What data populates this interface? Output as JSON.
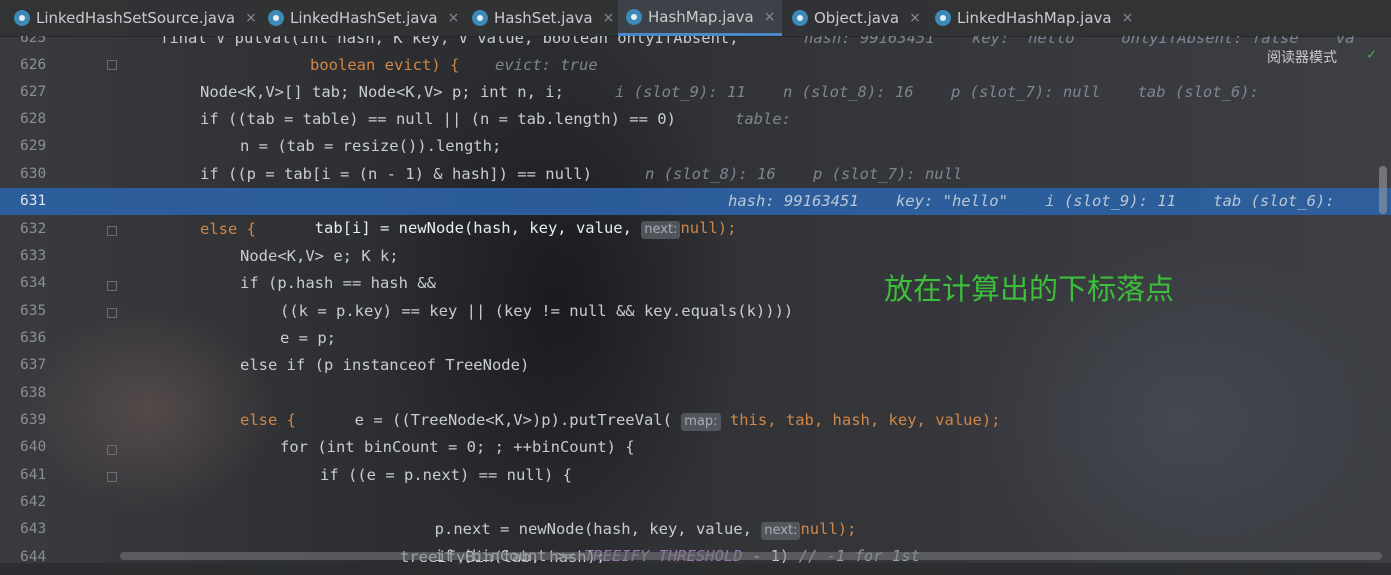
{
  "tabs": [
    {
      "label": "LinkedHashSetSource.java",
      "active": false
    },
    {
      "label": "LinkedHashSet.java",
      "active": false
    },
    {
      "label": "HashSet.java",
      "active": false
    },
    {
      "label": "HashMap.java",
      "active": true
    },
    {
      "label": "Object.java",
      "active": false
    },
    {
      "label": "LinkedHashMap.java",
      "active": false
    }
  ],
  "close_glyph": "×",
  "reader_mode": "阅读器模式",
  "annotation": "放在计算出的下标落点",
  "lines": [
    {
      "num": "625",
      "code": "final V putVal(int hash, K key, V value, boolean onlyIfAbsent,",
      "hint": "hash: 99163451    key: \"hello\"    onlyIfAbsent: false    va"
    },
    {
      "num": "626",
      "code": "boolean evict) {",
      "hint": "evict: true"
    },
    {
      "num": "627",
      "code": "Node<K,V>[] tab; Node<K,V> p; int n, i;",
      "hint": "i (slot_9): 11    n (slot_8): 16    p (slot_7): null    tab (slot_6):"
    },
    {
      "num": "628",
      "code": "if ((tab = table) == null || (n = tab.length) == 0)",
      "hint": "table:"
    },
    {
      "num": "629",
      "code": "n = (tab = resize()).length;",
      "hint": ""
    },
    {
      "num": "630",
      "code": "if ((p = tab[i = (n - 1) & hash]) == null)",
      "hint": "n (slot_8): 16    p (slot_7): null"
    },
    {
      "num": "631",
      "code_a": "tab[i] = newNode(hash, key, value, ",
      "param": "next:",
      "code_b": "null);",
      "hint": "hash: 99163451    key: \"hello\"    i (slot_9): 11    tab (slot_6):"
    },
    {
      "num": "632",
      "code": "else {",
      "hint": ""
    },
    {
      "num": "633",
      "code": "Node<K,V> e; K k;",
      "hint": ""
    },
    {
      "num": "634",
      "code": "if (p.hash == hash &&",
      "hint": ""
    },
    {
      "num": "635",
      "code": "((k = p.key) == key || (key != null && key.equals(k))))",
      "hint": ""
    },
    {
      "num": "636",
      "code": "e = p;",
      "hint": ""
    },
    {
      "num": "637",
      "code": "else if (p instanceof TreeNode)",
      "hint": ""
    },
    {
      "num": "638",
      "code_a": "e = ((TreeNode<K,V>)p).putTreeVal( ",
      "param": "map:",
      "code_b": "this, tab, hash, key, value);",
      "hint": ""
    },
    {
      "num": "639",
      "code": "else {",
      "hint": ""
    },
    {
      "num": "640",
      "code": "for (int binCount = 0; ; ++binCount) {",
      "hint": ""
    },
    {
      "num": "641",
      "code": "if ((e = p.next) == null) {",
      "hint": ""
    },
    {
      "num": "642",
      "code_a": "p.next = newNode(hash, key, value, ",
      "param": "next:",
      "code_b": "null);",
      "hint": ""
    },
    {
      "num": "643",
      "code_a": "if (binCount >= ",
      "const": "TREEIFY_THRESHOLD",
      "code_b": " - 1) ",
      "comment": "// -1 for 1st",
      "hint": ""
    },
    {
      "num": "644",
      "code": "treeifyBin(tab, hash);",
      "hint": ""
    }
  ]
}
